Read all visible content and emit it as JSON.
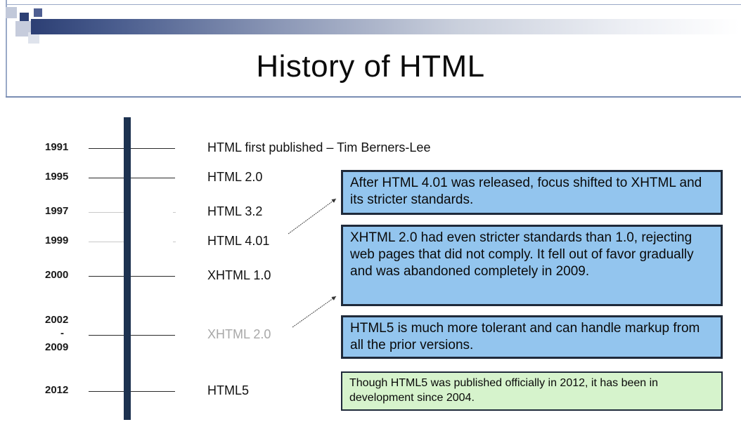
{
  "slide": {
    "title": "History of HTML"
  },
  "timeline": [
    {
      "year": "1991",
      "version": "HTML first published – Tim Berners-Lee"
    },
    {
      "year": "1995",
      "version": "HTML 2.0"
    },
    {
      "year": "1997",
      "version": "HTML 3.2"
    },
    {
      "year": "1999",
      "version": "HTML 4.01"
    },
    {
      "year": "2000",
      "version": "XHTML 1.0"
    },
    {
      "year_start": "2002",
      "year_sep": "-",
      "year_end": "2009",
      "version": "XHTML 2.0"
    },
    {
      "year": "2012",
      "version": "HTML5"
    }
  ],
  "callouts": [
    {
      "text": "After HTML 4.01 was released, focus shifted to XHTML and its stricter standards.",
      "color": "#93c5ee"
    },
    {
      "text": "XHTML 2.0 had even stricter standards than 1.0, rejecting web pages that did not comply.  It fell out of favor gradually and was abandoned completely in 2009.",
      "color": "#93c5ee"
    },
    {
      "text": "HTML5 is much more tolerant and can handle markup from all the prior versions.",
      "color": "#93c5ee"
    },
    {
      "text": "Though HTML5 was published officially in 2012, it has been in development since 2004.",
      "color": "#d6f3cc"
    }
  ],
  "colors": {
    "timeline_axis": "#1d3250",
    "header_bar": "#2c3f74"
  }
}
